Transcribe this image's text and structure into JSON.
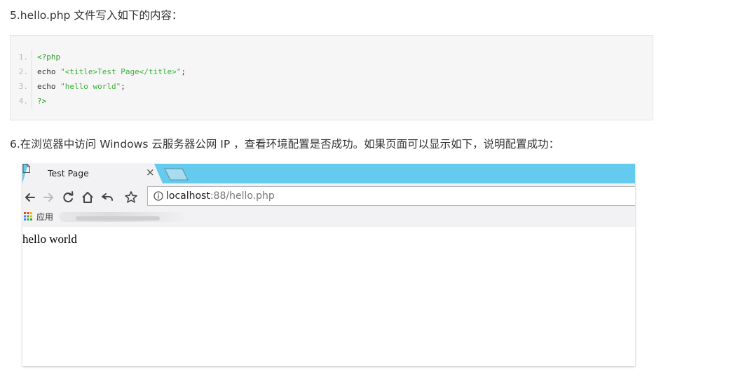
{
  "headings": {
    "step5": "5.hello.php 文件写入如下的内容：",
    "step6": "6.在浏览器中访问 Windows 云服务器公网 IP ，查看环境配置是否成功。如果页面可以显示如下，说明配置成功："
  },
  "code": {
    "lines": [
      {
        "number": "1.",
        "parts": [
          {
            "text": "<?php",
            "kind": "php"
          }
        ]
      },
      {
        "number": "2.",
        "parts": [
          {
            "text": "echo ",
            "kind": "plain"
          },
          {
            "text": "\"<title>Test Page</title>\"",
            "kind": "str"
          },
          {
            "text": ";",
            "kind": "plain"
          }
        ]
      },
      {
        "number": "3.",
        "parts": [
          {
            "text": "echo ",
            "kind": "plain"
          },
          {
            "text": "\"hello world\"",
            "kind": "str"
          },
          {
            "text": ";",
            "kind": "plain"
          }
        ]
      },
      {
        "number": "4.",
        "parts": [
          {
            "text": "?>",
            "kind": "php"
          }
        ]
      }
    ]
  },
  "browser": {
    "tab_title": "Test Page",
    "tab_close": "×",
    "url_host": "localhost",
    "url_rest": ":88/hello.php",
    "bookmarks_apps_label": "应用",
    "page_content": "hello world",
    "colors": {
      "tabstrip": "#64cbee",
      "toolbar": "#f2f2f4"
    },
    "icons": [
      "page-icon",
      "close-icon",
      "new-tab-icon",
      "back-arrow-icon",
      "forward-arrow-icon",
      "reload-icon",
      "home-icon",
      "undo-icon",
      "star-icon",
      "info-icon",
      "apps-grid-icon"
    ]
  }
}
